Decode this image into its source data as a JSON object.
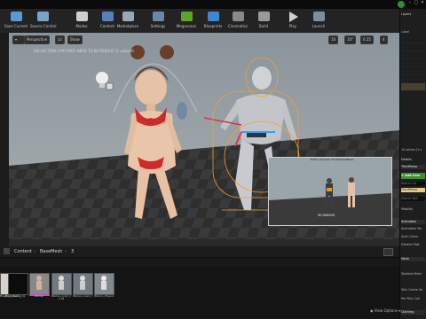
{
  "toolbar": {
    "buttons": [
      {
        "label": "Save Current",
        "icon": "save-icon"
      },
      {
        "label": "Source Control",
        "icon": "source-control-icon"
      },
      {
        "label": "Modes",
        "icon": "modes-icon"
      },
      {
        "label": "Content",
        "icon": "content-icon"
      },
      {
        "label": "Marketplace",
        "icon": "marketplace-icon"
      },
      {
        "label": "Settings",
        "icon": "settings-icon"
      },
      {
        "label": "Megascans",
        "icon": "megascans-icon"
      },
      {
        "label": "Blueprints",
        "icon": "blueprints-icon"
      },
      {
        "label": "Cinematics",
        "icon": "cinematics-icon"
      },
      {
        "label": "Build",
        "icon": "build-icon"
      },
      {
        "label": "Play",
        "icon": "play-icon"
      },
      {
        "label": "Launch",
        "icon": "launch-icon"
      }
    ]
  },
  "viewport": {
    "perspective_label": "Perspective",
    "lit_label": "Lit",
    "show_label": "Show",
    "warning_text": "REFLECTION CAPTURES NEED TO BE REBUILT (1 unbuilt)",
    "snap_values": [
      "10",
      "10°",
      "0.25",
      "4"
    ]
  },
  "preview": {
    "title": "Editor Preview: FbxSkeletalMesh",
    "readout": "90.000000"
  },
  "right_panel": {
    "layers_label": "Layers",
    "label_header": "Label",
    "actor_count": "10 actors (1 s",
    "details_label": "Details",
    "selected_name": "ThirdPerso",
    "add_component": "+ Add Com",
    "search_placeholder": "Search Co",
    "selected_component": "ThirdPerso",
    "search_details": "Search Det",
    "section_mobility": "Mobility",
    "section_animation": "Animation",
    "animation_rows": [
      "Animation Mo",
      "Anim Class",
      "Disable Post"
    ],
    "section_mesh": "Mesh",
    "mesh_rows": [
      "Skeletal Mesh"
    ],
    "extra_rows": [
      "Skin Cache Us",
      "Per Poly Coll"
    ],
    "section_clothing": "Clothing"
  },
  "content_browser": {
    "breadcrumb": [
      "Content",
      "BaseMesh",
      "3"
    ],
    "view_options": "View Options",
    "assets": [
      {
        "label": "BluePrint_Blender"
      },
      {
        "label": "Bay_Loading_Skeleton_n_lightmk/1"
      },
      {
        "label": "Woman"
      },
      {
        "label": "Woman_Anim_ll_Ba_Jaw Jr 18"
      },
      {
        "label": "Woman_Anim_Optimation"
      },
      {
        "label": "Woman_PhysicsAsset"
      }
    ]
  },
  "colors": {
    "accent_orange": "#f2a030",
    "add_green": "#3e8f2e",
    "megascans_green": "#5aa62a",
    "selection": "#1d5fa8"
  }
}
